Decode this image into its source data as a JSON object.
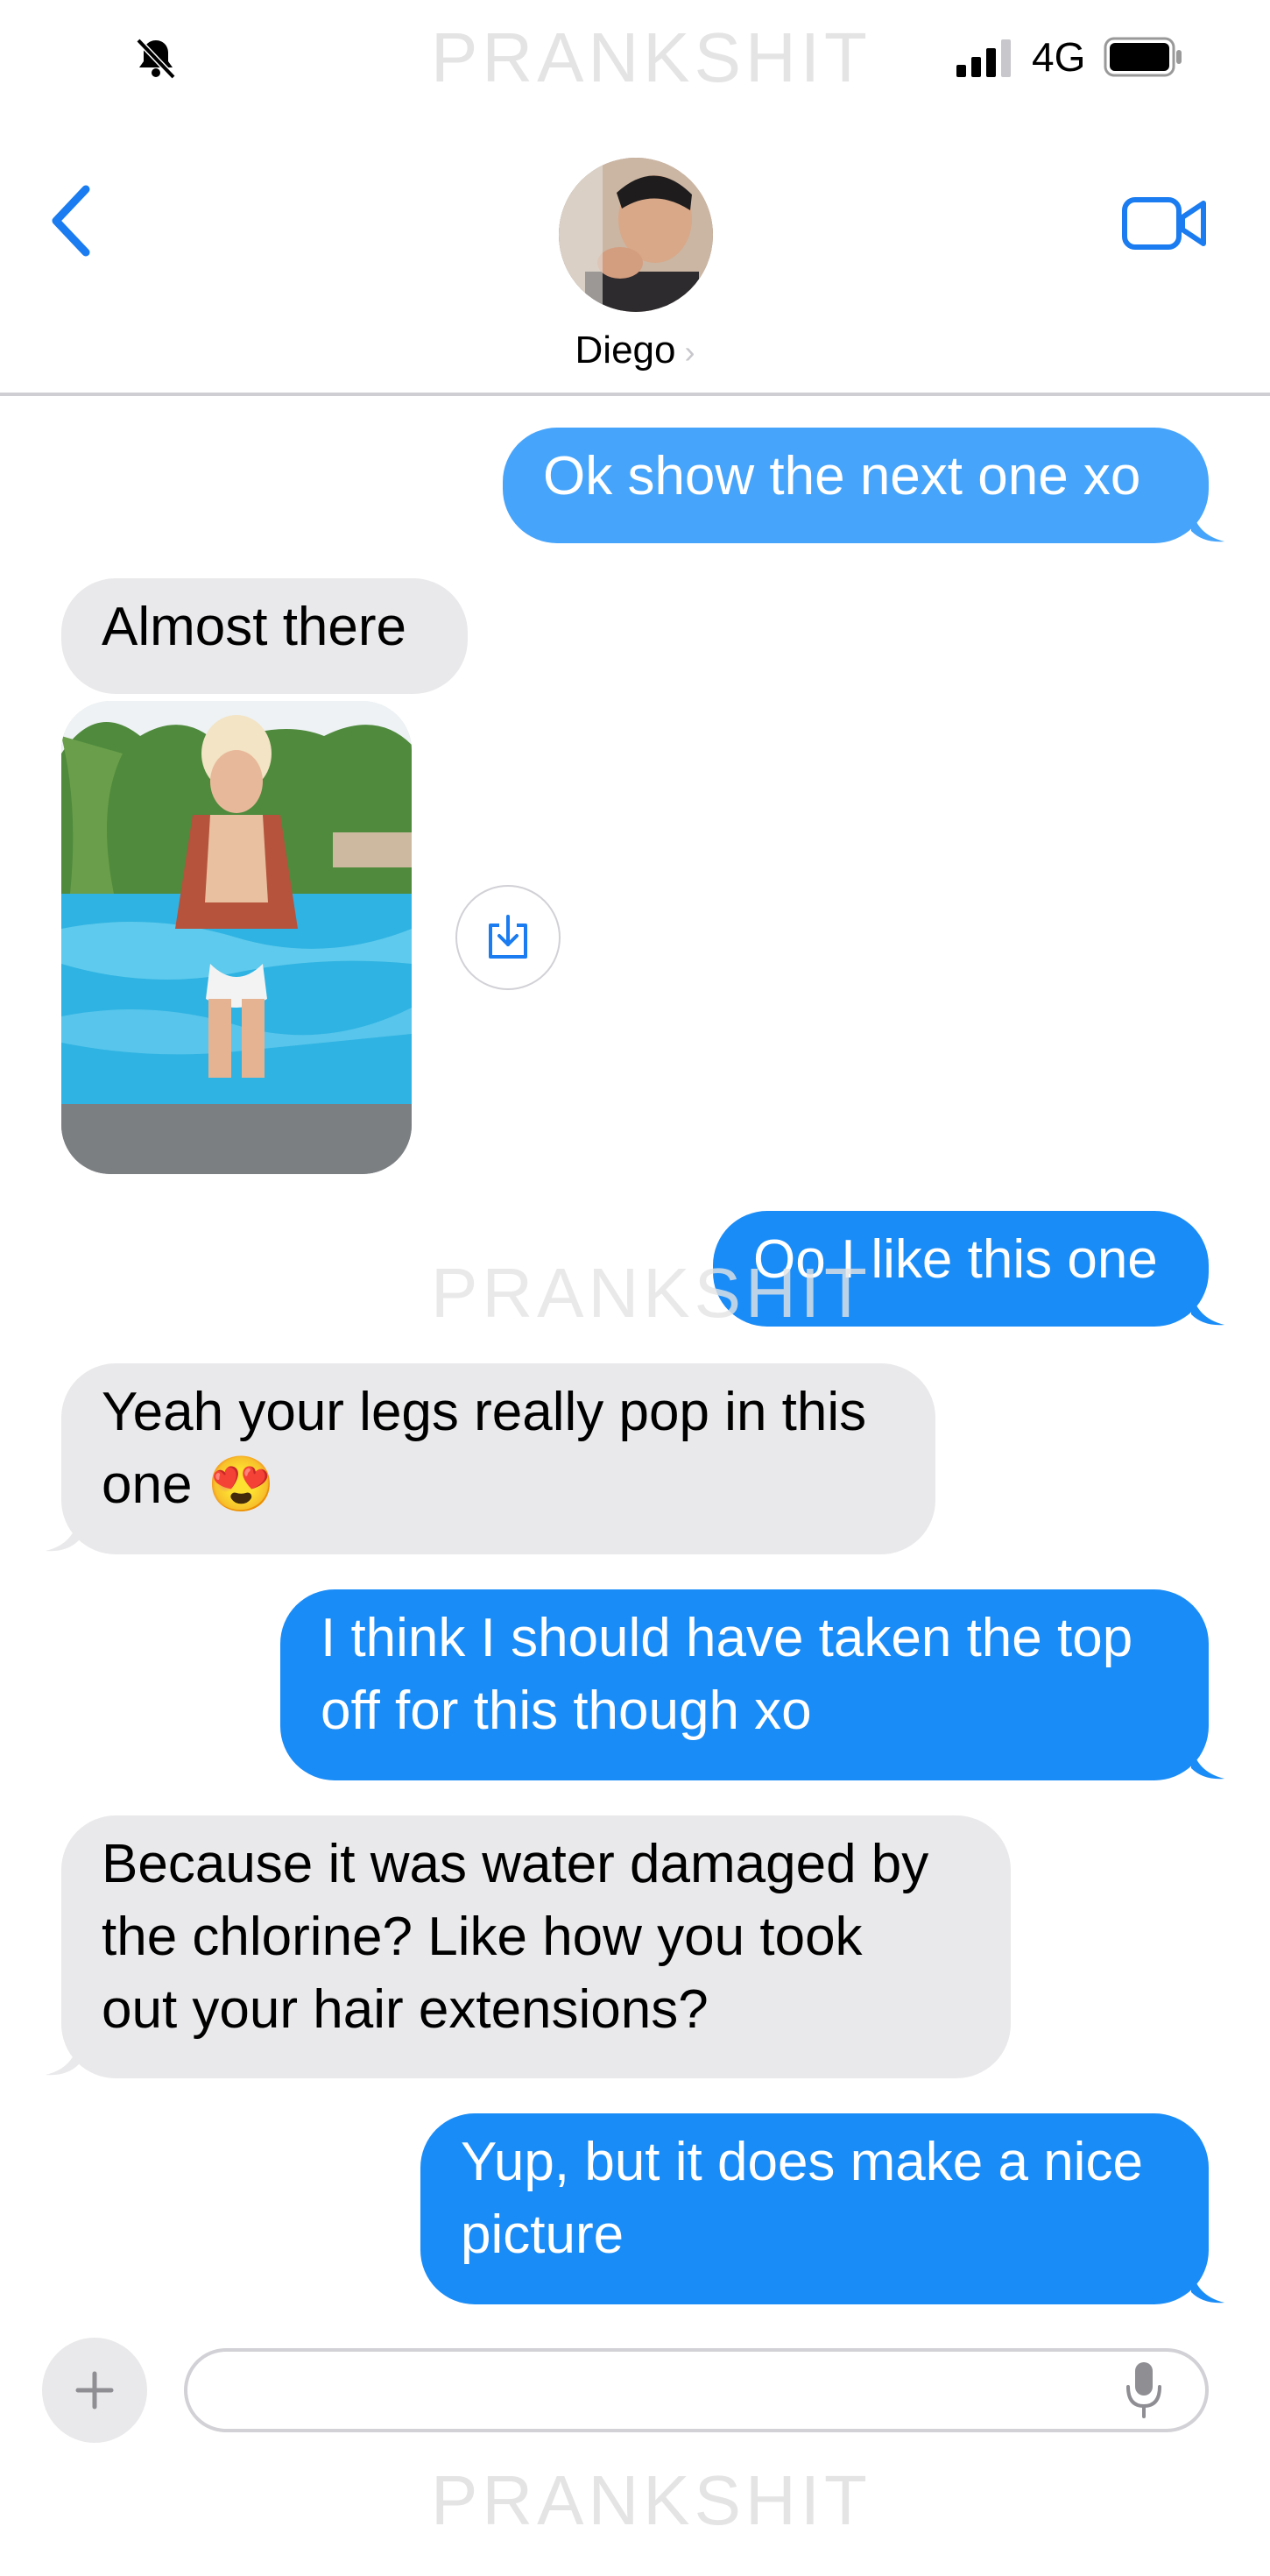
{
  "status_bar": {
    "network": "4G",
    "watermark": "PRANKSHIT"
  },
  "header": {
    "contact_name": "Diego",
    "chevron": "›"
  },
  "messages": [
    {
      "direction": "sent",
      "text": "Ok show the next one xo"
    },
    {
      "direction": "received",
      "text": "Almost there"
    },
    {
      "direction": "received",
      "type": "image"
    },
    {
      "direction": "sent",
      "text": "Oo I like this one"
    },
    {
      "direction": "received",
      "text": "Yeah your legs really pop in this\none 😍"
    },
    {
      "direction": "sent",
      "text": "I think I should have taken the top\noff for this though xo"
    },
    {
      "direction": "received",
      "text": "Because it was water damaged by\nthe chlorine? Like how you took\nout your hair extensions?"
    },
    {
      "direction": "sent",
      "text": "Yup, but it does make a nice\npicture"
    }
  ],
  "watermarks": [
    "PRANKSHIT",
    "PRANKSHIT"
  ],
  "input_bar": {
    "placeholder": ""
  },
  "colors": {
    "sent_bubble": "#1a8cf7",
    "received_bubble": "#e9e9eb",
    "accent": "#1a7cf0"
  },
  "icons": [
    "bell-slash-icon",
    "signal-icon",
    "battery-icon",
    "back-chevron-icon",
    "video-camera-icon",
    "save-download-icon",
    "plus-icon",
    "microphone-icon"
  ]
}
